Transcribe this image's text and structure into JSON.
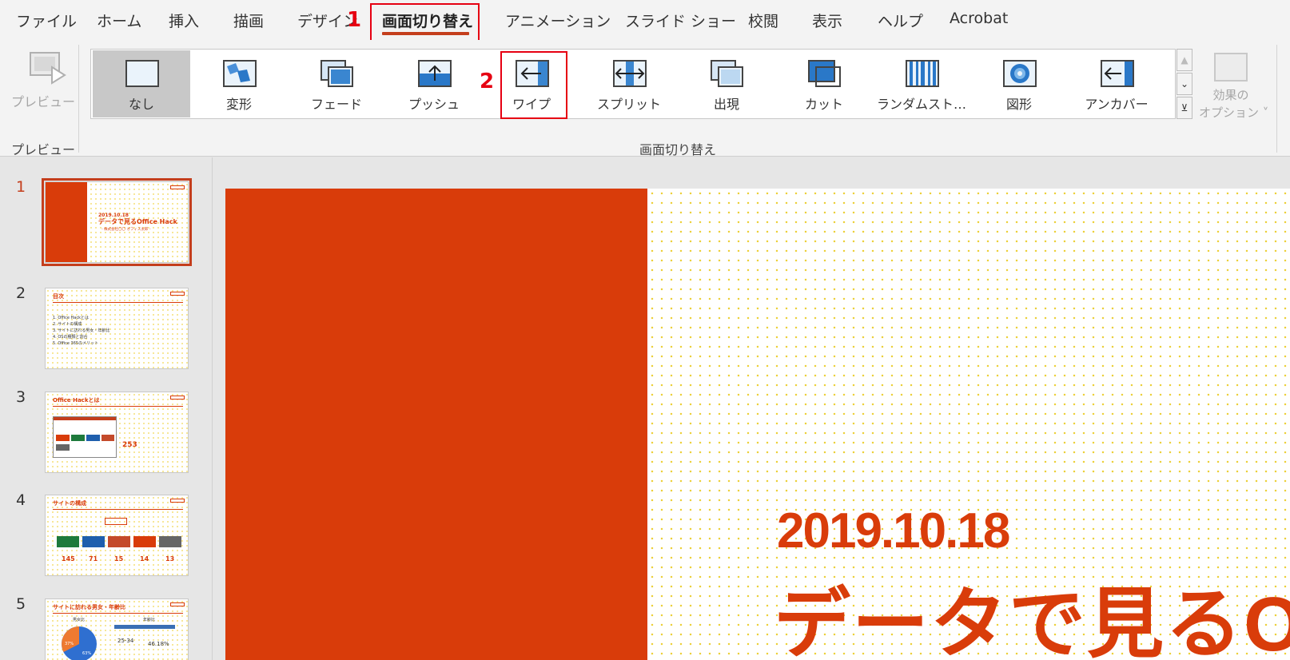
{
  "tabs": [
    {
      "label": "ファイル"
    },
    {
      "label": "ホーム"
    },
    {
      "label": "挿入"
    },
    {
      "label": "描画"
    },
    {
      "label": "デザイン"
    },
    {
      "label": "画面切り替え"
    },
    {
      "label": "アニメーション"
    },
    {
      "label": "スライド ショー"
    },
    {
      "label": "校閲"
    },
    {
      "label": "表示"
    },
    {
      "label": "ヘルプ"
    },
    {
      "label": "Acrobat"
    }
  ],
  "annotations": {
    "step1": "1",
    "step2": "2"
  },
  "ribbon": {
    "preview_button_label": "プレビュー",
    "preview_group_label": "プレビュー",
    "transitions_group_label": "画面切り替え",
    "effect_options_line1": "効果の",
    "effect_options_line2": "オプション ˅",
    "gallery": [
      {
        "label": "なし",
        "icon": "none-transition-icon"
      },
      {
        "label": "変形",
        "icon": "morph-transition-icon"
      },
      {
        "label": "フェード",
        "icon": "fade-transition-icon"
      },
      {
        "label": "プッシュ",
        "icon": "push-transition-icon"
      },
      {
        "label": "ワイプ",
        "icon": "wipe-transition-icon"
      },
      {
        "label": "スプリット",
        "icon": "split-transition-icon"
      },
      {
        "label": "出現",
        "icon": "reveal-transition-icon"
      },
      {
        "label": "カット",
        "icon": "cut-transition-icon"
      },
      {
        "label": "ランダムスト…",
        "icon": "random-bars-transition-icon"
      },
      {
        "label": "図形",
        "icon": "shape-transition-icon"
      },
      {
        "label": "アンカバー",
        "icon": "uncover-transition-icon"
      }
    ],
    "selected_index": 0
  },
  "thumbnails": {
    "numbers": [
      "1",
      "2",
      "3",
      "4",
      "5"
    ],
    "s1": {
      "date": "2019.10.18",
      "title": "データで見るOffice Hack",
      "sub": "- 株式会社〇〇 オフィス太郎 -"
    },
    "s2": {
      "title": "目次",
      "items": [
        "1. Office Hackとは",
        "2. サイトの構成",
        "3. サイトに訪れる男女・年齢比",
        "4. OSの種類と割合",
        "5. Office 365のメリット"
      ]
    },
    "s3": {
      "title": "Office Hackとは",
      "num": "253"
    },
    "s4": {
      "title": "サイトの構成",
      "values": [
        "145",
        "71",
        "15",
        "14",
        "13"
      ]
    },
    "s5": {
      "title": "サイトに訪れる男女・年齢比",
      "left_head": "男女比",
      "right_head": "年齢比",
      "age": "25-34",
      "pct": "46.18%",
      "pie_a": "37%",
      "pie_b": "63%"
    }
  },
  "slide": {
    "date": "2019.10.18",
    "title": "データで見るOffice Hack"
  },
  "colors": {
    "accent": "#d93c0a",
    "tab_underline": "#c43e1c",
    "annotation": "#e60012"
  }
}
